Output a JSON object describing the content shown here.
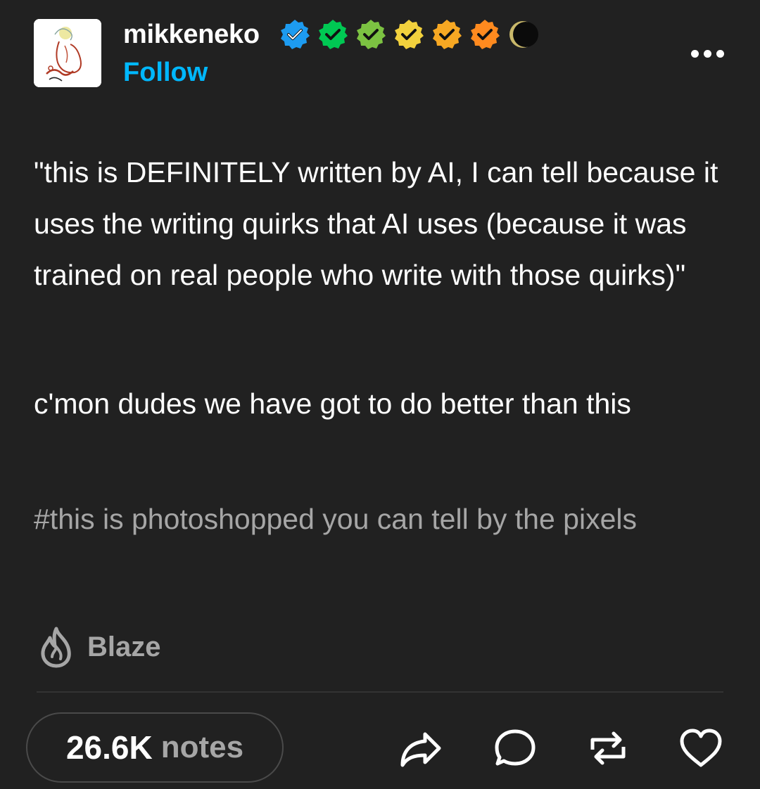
{
  "post": {
    "author": {
      "username": "mikkeneko",
      "follow_label": "Follow",
      "avatar_icon": "sketch-cat-avatar",
      "badges": [
        {
          "icon": "verified-badge",
          "color": "#1d9bf0"
        },
        {
          "icon": "verified-badge",
          "color": "#00c853"
        },
        {
          "icon": "verified-badge",
          "color": "#7cc242"
        },
        {
          "icon": "verified-badge",
          "color": "#f2d13d"
        },
        {
          "icon": "verified-badge",
          "color": "#f7a823"
        },
        {
          "icon": "verified-badge",
          "color": "#ff8a1f"
        },
        {
          "icon": "crescent-moon-badge",
          "color": "#c9b86a"
        }
      ]
    },
    "more_icon": "more-dots-icon",
    "paragraphs": [
      "\"this is DEFINITELY written by AI, I can tell because it uses the writing quirks that AI uses (because it was trained on real people who write with those quirks)\"",
      "c'mon dudes we have got to do better than this"
    ],
    "tags": "#this is photoshopped you can tell by the pixels",
    "blaze": {
      "icon": "flame-icon",
      "label": "Blaze"
    },
    "footer": {
      "notes_count": "26.6K",
      "notes_label": "notes",
      "actions": [
        {
          "name": "share",
          "icon": "share-arrow-icon"
        },
        {
          "name": "reply",
          "icon": "speech-bubble-icon"
        },
        {
          "name": "reblog",
          "icon": "reblog-icon"
        },
        {
          "name": "like",
          "icon": "heart-icon"
        }
      ]
    },
    "colors": {
      "background": "#212121",
      "text": "#ffffff",
      "muted": "#a6a6a6",
      "follow": "#00b8ff"
    }
  }
}
